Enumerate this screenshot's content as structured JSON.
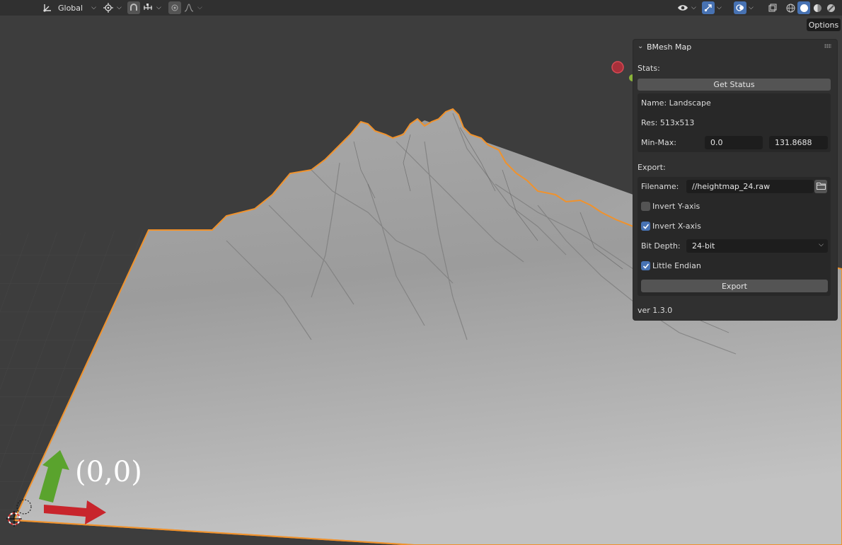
{
  "header": {
    "orientation_label": "Global",
    "icons": [
      "transform-orientation-icon",
      "pivot-point-icon",
      "snap-icon",
      "snap-increment-icon",
      "proportional-editing-icon",
      "falloff-curve-icon",
      "visibility-eye-icon",
      "gizmo-icon",
      "overlay-icon",
      "xray-toggle-icon",
      "shading-wireframe-icon",
      "shading-solid-icon",
      "shading-material-icon",
      "shading-rendered-icon"
    ]
  },
  "options_label": "Options",
  "panel": {
    "title": "BMesh Map",
    "stats_label": "Stats:",
    "get_status_label": "Get Status",
    "name_text": "Name: Landscape",
    "res_text": "Res: 513x513",
    "minmax_label": "Min-Max:",
    "min_value": "0.0",
    "max_value": "131.8688",
    "export_label": "Export:",
    "filename_label": "Filename:",
    "filename_value": "//heightmap_24.raw",
    "invert_y_label": "Invert Y-axis",
    "invert_y_checked": false,
    "invert_x_label": "Invert X-axis",
    "invert_x_checked": true,
    "bit_depth_label": "Bit Depth:",
    "bit_depth_value": "24-bit",
    "little_endian_label": "Little Endian",
    "little_endian_checked": true,
    "export_button_label": "Export",
    "version": "ver 1.3.0"
  },
  "annotation": {
    "origin_label": "(0,0)"
  },
  "colors": {
    "viewport_bg": "#3d3d3d",
    "terrain": "#b8b8b8",
    "selection_outline": "#f0922c",
    "accent_blue": "#4772b3",
    "x_arrow": "#c8252c",
    "y_arrow": "#5aa32d"
  }
}
